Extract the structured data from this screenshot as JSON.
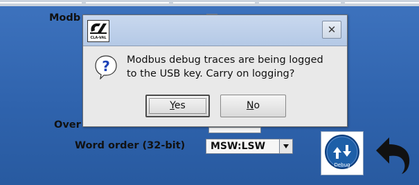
{
  "background": {
    "labels": {
      "modbus_partial": "Modb",
      "over_partial": "Over",
      "word_order": "Word order (32-bit)"
    },
    "word_order_select": {
      "value": "MSW:LSW"
    },
    "debug_button": {
      "label": "Debug",
      "icon": "debug-arrows-icon"
    },
    "back_button": {
      "icon": "back-arrow-icon"
    }
  },
  "dialog": {
    "logo_text": "CLA-VAL",
    "close_label": "✕",
    "icon": "question-icon",
    "message_lines": [
      "Modbus debug traces are being logged",
      "to the USB key. Carry on logging?"
    ],
    "buttons": {
      "yes": {
        "mnemonic": "Y",
        "rest": "es"
      },
      "no": {
        "mnemonic": "N",
        "rest": "o"
      }
    }
  },
  "colors": {
    "background": "#2f63ad",
    "dialog_title": "#c0d2ea",
    "debug_circle": "#1d5fa8"
  }
}
